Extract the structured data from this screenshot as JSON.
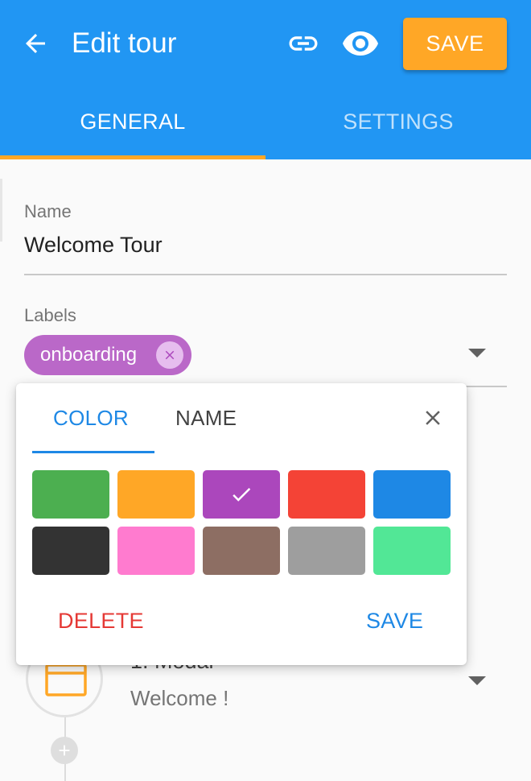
{
  "header": {
    "title": "Edit tour",
    "save_label": "SAVE",
    "icons": [
      "arrow-left-icon",
      "link-icon",
      "eye-icon"
    ]
  },
  "tabs": [
    {
      "label": "GENERAL",
      "active": true
    },
    {
      "label": "SETTINGS",
      "active": false
    }
  ],
  "form": {
    "name_label": "Name",
    "name_value": "Welcome Tour",
    "labels_label": "Labels",
    "chips": [
      {
        "label": "onboarding",
        "color": "#ba68c8"
      }
    ]
  },
  "step": {
    "title": "1. Modal",
    "subtitle": "Welcome !"
  },
  "label_popup": {
    "tabs": [
      {
        "label": "COLOR",
        "active": true
      },
      {
        "label": "NAME",
        "active": false
      }
    ],
    "selected_color": "#ab47bc",
    "colors": [
      "#4caf50",
      "#ffa726",
      "#ab47bc",
      "#f44336",
      "#1e88e5",
      "#333333",
      "#ff7bcf",
      "#8d6e63",
      "#9e9e9e",
      "#52e796"
    ],
    "delete_label": "DELETE",
    "save_label": "SAVE"
  },
  "colors": {
    "primary": "#2196f3",
    "accent": "#ffa726",
    "link": "#1e88e5",
    "danger": "#e53935"
  }
}
